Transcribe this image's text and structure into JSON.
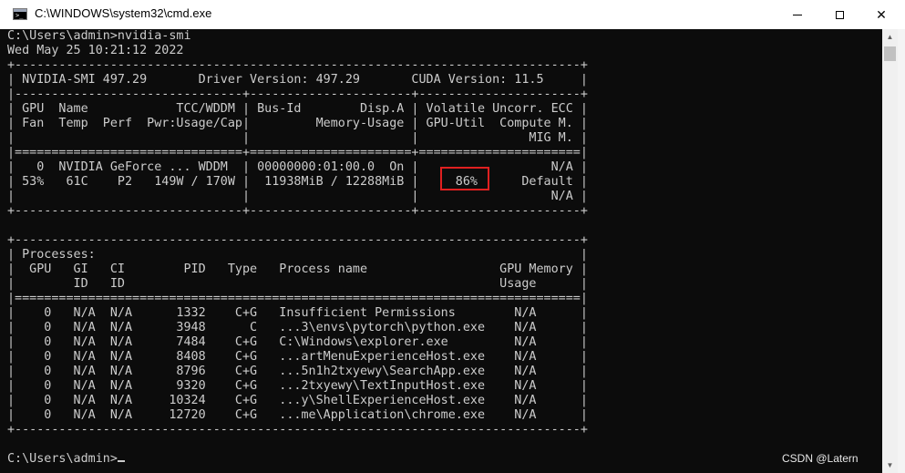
{
  "window": {
    "title": "C:\\WINDOWS\\system32\\cmd.exe",
    "icon": "cmd-icon",
    "icon_text": ">_"
  },
  "controls": {
    "minimize": "minimize-icon",
    "maximize": "maximize-icon",
    "close_glyph": "✕"
  },
  "console": {
    "pre": "C:\\Users\\admin>nvidia-smi\nWed May 25 10:21:12 2022\n+-----------------------------------------------------------------------------+\n| NVIDIA-SMI 497.29       Driver Version: 497.29       CUDA Version: 11.5     |\n|-------------------------------+----------------------+----------------------+\n| GPU  Name            TCC/WDDM | Bus-Id        Disp.A | Volatile Uncorr. ECC |\n| Fan  Temp  Perf  Pwr:Usage/Cap|         Memory-Usage | GPU-Util  Compute M. |\n|                               |                      |               MIG M. |\n|===============================+======================+======================|\n|   0  NVIDIA GeForce ... WDDM  | 00000000:01:00.0  On |                  N/A |\n| 53%   61C    P2   149W / 170W |  11938MiB / 12288MiB |     ",
    "gpu_util": "86%",
    "mid": "      Default |\n|                               |                      |                  N/A |\n+-------------------------------+----------------------+----------------------+\n\n+-----------------------------------------------------------------------------+\n| Processes:                                                                  |\n|  GPU   GI   CI        PID   Type   Process name                  GPU Memory |\n|        ID   ID                                                   Usage      |\n|=============================================================================|\n|    0   N/A  N/A      1332    C+G   Insufficient Permissions        N/A      |\n|    0   N/A  N/A      3948      C   ...3\\envs\\pytorch\\python.exe    N/A      |\n|    0   N/A  N/A      7484    C+G   C:\\Windows\\explorer.exe         N/A      |\n|    0   N/A  N/A      8408    C+G   ...artMenuExperienceHost.exe    N/A      |\n|    0   N/A  N/A      8796    C+G   ...5n1h2txyewy\\SearchApp.exe    N/A      |\n|    0   N/A  N/A      9320    C+G   ...2txyewy\\TextInputHost.exe    N/A      |\n|    0   N/A  N/A     10324    C+G   ...y\\ShellExperienceHost.exe    N/A      |\n|    0   N/A  N/A     12720    C+G   ...me\\Application\\chrome.exe    N/A      |\n+-----------------------------------------------------------------------------+\n\nC:\\Users\\admin>",
    "highlight_color": "#e02020",
    "text_color": "#cccccc",
    "background": "#0c0c0c"
  },
  "scrollbar": {
    "up": "▲",
    "down": "▼"
  },
  "watermark": "CSDN @Latern"
}
